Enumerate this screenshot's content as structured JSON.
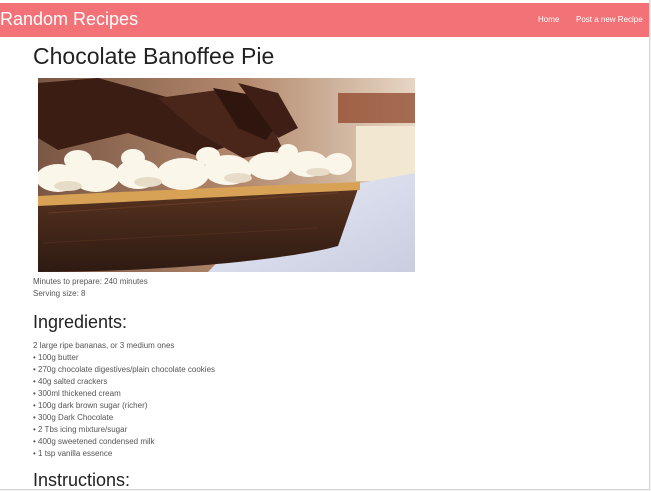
{
  "navbar": {
    "brand": "Random Recipes",
    "links": [
      "Home",
      "Post a new Recipe"
    ],
    "background_color": "#f37277"
  },
  "recipe": {
    "title": "Chocolate Banoffee Pie",
    "minutes_label": "Minutes to prepare: 240 minutes",
    "serving_label": "Serving size: 8",
    "ingredients_heading": "Ingredients:",
    "ingredients": [
      "2 large ripe bananas, or 3 medium ones",
      "• 100g butter",
      "• 270g chocolate digestives/plain chocolate cookies",
      "• 40g salted crackers",
      "• 300ml thickened cream",
      "• 100g dark brown sugar (richer)",
      "• 300g Dark Chocolate",
      "• 2 Tbs icing mixture/sugar",
      "• 400g sweetened condensed milk",
      "• 1 tsp vanilla essence"
    ],
    "instructions_heading": "Instructions:"
  }
}
